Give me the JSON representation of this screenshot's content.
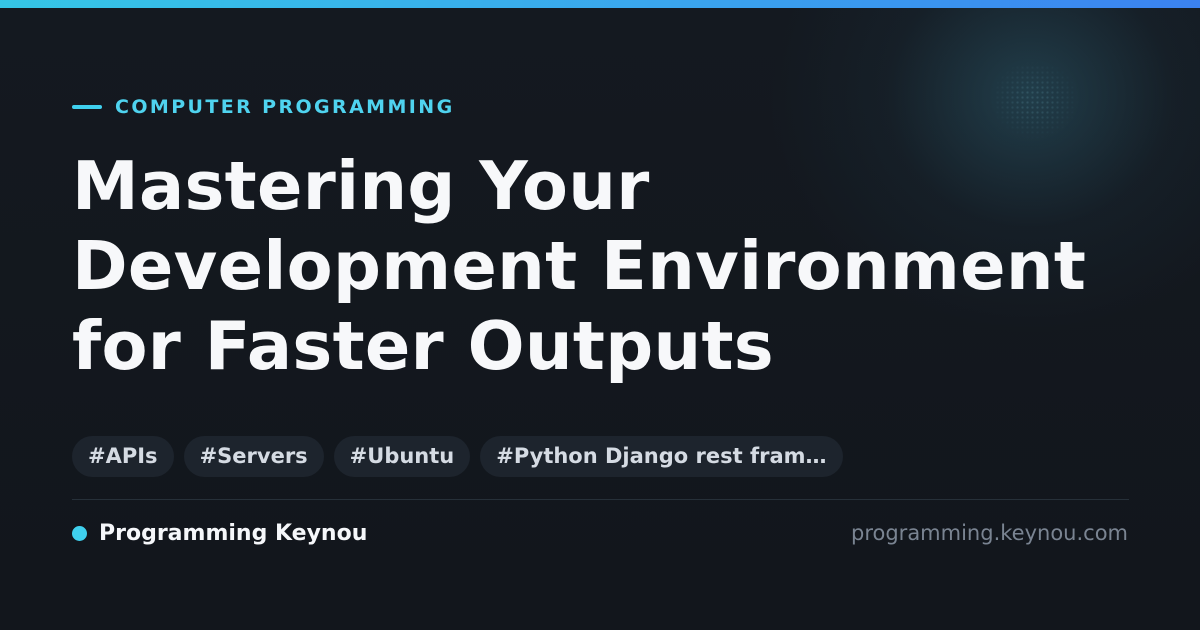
{
  "category": "COMPUTER PROGRAMMING",
  "title_lines": [
    "Mastering Your",
    "Development Environment",
    "for Faster Outputs"
  ],
  "tags": [
    "#APIs",
    "#Servers",
    "#Ubuntu",
    "#Python Django rest fram…"
  ],
  "footer": {
    "brand": "Programming Keynou",
    "url": "programming.keynou.com"
  },
  "colors": {
    "accent": "#3fd0ee",
    "top_bar_start": "#35c6e6",
    "top_bar_end": "#3b82f0",
    "background": "#12161d",
    "title": "#f7f8fa",
    "tag_background": "#1d242d",
    "url_text": "#7a8492"
  }
}
